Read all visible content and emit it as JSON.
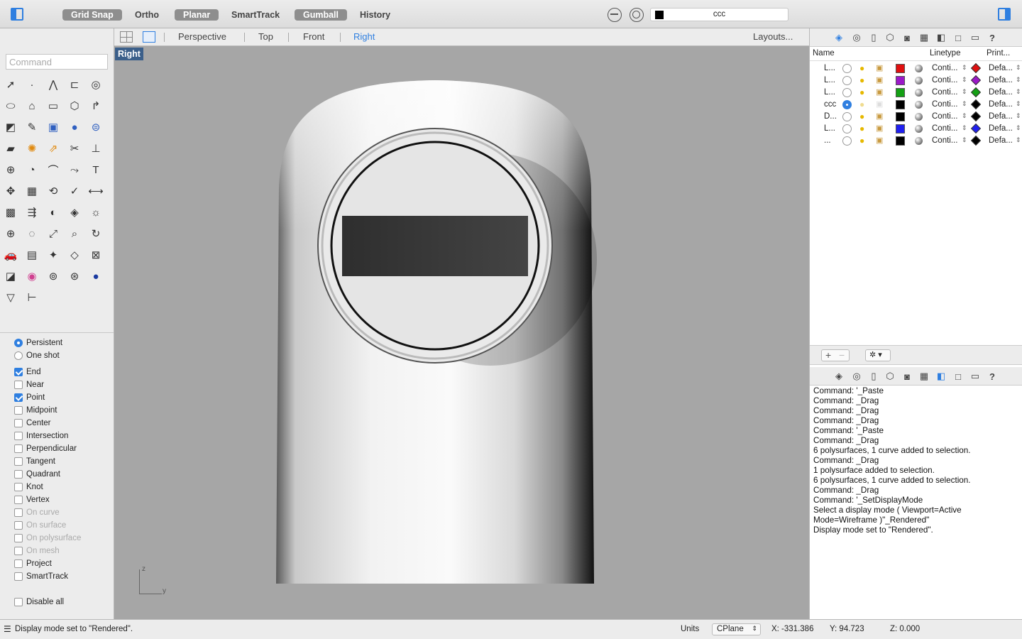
{
  "toolbar": {
    "grid_snap": "Grid Snap",
    "ortho": "Ortho",
    "planar": "Planar",
    "smarttrack": "SmartTrack",
    "gumball": "Gumball",
    "history": "History",
    "current_layer": "ccc"
  },
  "viewport_tabs": {
    "perspective": "Perspective",
    "top": "Top",
    "front": "Front",
    "right": "Right",
    "layouts": "Layouts..."
  },
  "viewport": {
    "label": "Right",
    "axis_z": "z",
    "axis_y": "y"
  },
  "command": {
    "placeholder": "Command"
  },
  "tools": [
    "select-arrow",
    "point",
    "polyline",
    "rectangle-curve",
    "circle",
    "ellipse",
    "polygon-curve",
    "rectangle",
    "polygon",
    "arc",
    "surface-edge",
    "patch",
    "box",
    "sphere",
    "cylinder",
    "plane",
    "explode",
    "extrude",
    "trim",
    "split",
    "boolean",
    "fillet",
    "blend",
    "offset",
    "text",
    "move",
    "array",
    "transform",
    "check",
    "dimension",
    "rebuild",
    "align",
    "mirror",
    "mesh",
    "analyze",
    "zoom-window",
    "lasso",
    "zoom-extents",
    "zoom",
    "rotate-view",
    "car",
    "grid",
    "render",
    "light",
    "lock",
    "layer-state",
    "color-wheel",
    "render-sphere",
    "globe",
    "material-ball",
    "pipette",
    "cplane"
  ],
  "osnaps": {
    "persistent": "Persistent",
    "one_shot": "One shot",
    "end": "End",
    "near": "Near",
    "point": "Point",
    "midpoint": "Midpoint",
    "center": "Center",
    "intersection": "Intersection",
    "perpendicular": "Perpendicular",
    "tangent": "Tangent",
    "quadrant": "Quadrant",
    "knot": "Knot",
    "vertex": "Vertex",
    "on_curve": "On curve",
    "on_surface": "On surface",
    "on_polysurface": "On polysurface",
    "on_mesh": "On mesh",
    "project": "Project",
    "smarttrack": "SmartTrack",
    "disable_all": "Disable all"
  },
  "layers": {
    "header_name": "Name",
    "header_linetype": "Linetype",
    "header_print": "Print...",
    "rows": [
      {
        "name": "L...",
        "current": false,
        "color": "#e01010",
        "linetype": "Conti...",
        "print_color": "#e01010",
        "print_width": "Defa..."
      },
      {
        "name": "L...",
        "current": false,
        "color": "#9b19c8",
        "linetype": "Conti...",
        "print_color": "#9b19c8",
        "print_width": "Defa..."
      },
      {
        "name": "L...",
        "current": false,
        "color": "#14a014",
        "linetype": "Conti...",
        "print_color": "#14a014",
        "print_width": "Defa..."
      },
      {
        "name": "ccc",
        "current": true,
        "color": "#000000",
        "linetype": "Conti...",
        "print_color": "#000000",
        "print_width": "Defa..."
      },
      {
        "name": "D...",
        "current": false,
        "color": "#000000",
        "linetype": "Conti...",
        "print_color": "#000000",
        "print_width": "Defa..."
      },
      {
        "name": "L...",
        "current": false,
        "color": "#2020f0",
        "linetype": "Conti...",
        "print_color": "#2020f0",
        "print_width": "Defa..."
      },
      {
        "name": "...",
        "current": false,
        "color": "#000000",
        "linetype": "Conti...",
        "print_color": "#000000",
        "print_width": "Defa..."
      }
    ]
  },
  "command_history": [
    "Command: '_Paste",
    "Command: _Drag",
    "Command: _Drag",
    "Command: _Drag",
    "Command: '_Paste",
    "Command: _Drag",
    "6 polysurfaces, 1 curve added to selection.",
    "Command: _Drag",
    "1 polysurface added to selection.",
    "6 polysurfaces, 1 curve added to selection.",
    "Command: _Drag",
    "Command: '_SetDisplayMode",
    "Select a display mode ( Viewport=Active",
    "Mode=Wireframe )\"_Rendered\"",
    "Display mode set to \"Rendered\"."
  ],
  "status": {
    "message": "Display mode set to \"Rendered\".",
    "units": "Units",
    "cplane": "CPlane",
    "x": "X: -331.386",
    "y": "Y: 94.723",
    "z": "Z: 0.000"
  }
}
